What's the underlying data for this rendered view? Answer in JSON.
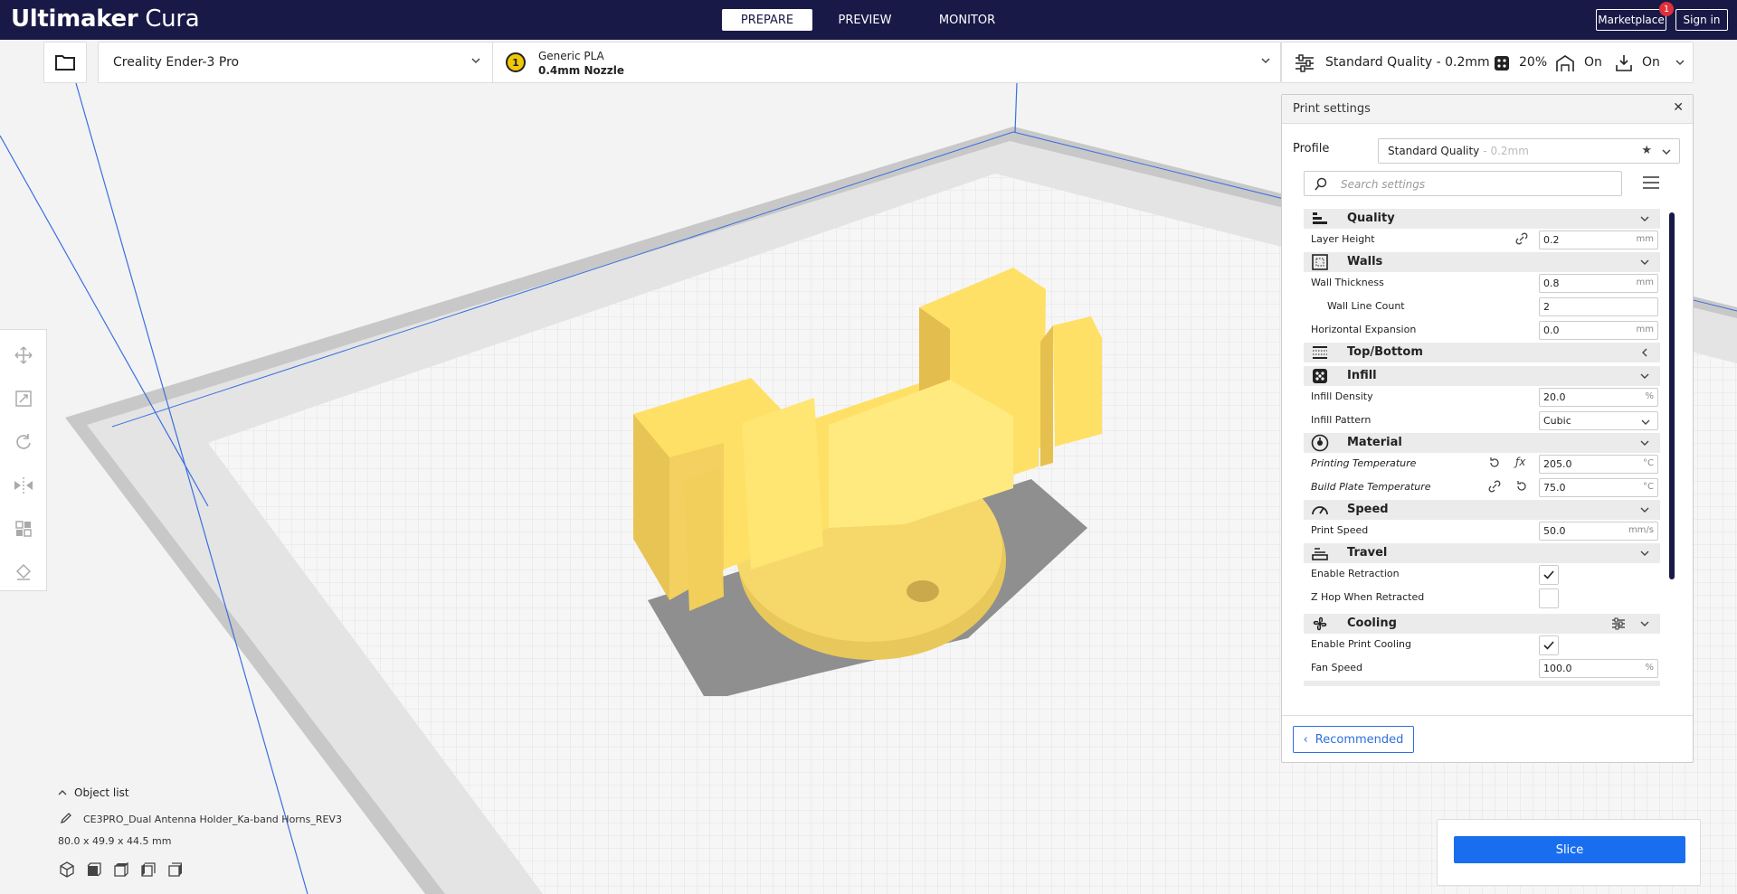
{
  "app": {
    "brand_bold": "Ultimaker",
    "brand_light": "Cura"
  },
  "stages": [
    {
      "label": "PREPARE"
    },
    {
      "label": "PREVIEW"
    },
    {
      "label": "MONITOR"
    }
  ],
  "header": {
    "marketplace": "Marketplace",
    "marketplace_badge": "1",
    "signin": "Sign in"
  },
  "machine": {
    "printer": "Creality Ender-3 Pro",
    "extruder_number": "1",
    "material": "Generic PLA",
    "nozzle": "0.4mm Nozzle"
  },
  "print_setup": {
    "quality": "Standard Quality - 0.2mm",
    "infill": "20%",
    "support": "On",
    "adhesion": "On"
  },
  "panel": {
    "title": "Print settings",
    "close": "✕",
    "profile_label": "Profile",
    "profile_value": "Standard Quality",
    "profile_sub": "- 0.2mm",
    "search_placeholder": "Search settings",
    "recommended_label": "Recommended",
    "categories": [
      {
        "label": "Quality"
      },
      {
        "label": "Walls"
      },
      {
        "label": "Top/Bottom"
      },
      {
        "label": "Infill"
      },
      {
        "label": "Material"
      },
      {
        "label": "Speed"
      },
      {
        "label": "Travel"
      },
      {
        "label": "Cooling"
      }
    ],
    "settings": {
      "layer_height": {
        "label": "Layer Height",
        "value": "0.2",
        "unit": "mm"
      },
      "wall_thickness": {
        "label": "Wall Thickness",
        "value": "0.8",
        "unit": "mm"
      },
      "wall_line_count": {
        "label": "Wall Line Count",
        "value": "2"
      },
      "horizontal_expansion": {
        "label": "Horizontal Expansion",
        "value": "0.0",
        "unit": "mm"
      },
      "infill_density": {
        "label": "Infill Density",
        "value": "20.0",
        "unit": "%"
      },
      "infill_pattern": {
        "label": "Infill Pattern",
        "value": "Cubic"
      },
      "printing_temperature": {
        "label": "Printing Temperature",
        "value": "205.0",
        "unit": "°C"
      },
      "build_plate_temperature": {
        "label": "Build Plate Temperature",
        "value": "75.0",
        "unit": "°C"
      },
      "print_speed": {
        "label": "Print Speed",
        "value": "50.0",
        "unit": "mm/s"
      },
      "enable_retraction": {
        "label": "Enable Retraction",
        "checked": true
      },
      "z_hop": {
        "label": "Z Hop When Retracted",
        "checked": false
      },
      "enable_print_cooling": {
        "label": "Enable Print Cooling",
        "checked": true
      },
      "fan_speed": {
        "label": "Fan Speed",
        "value": "100.0",
        "unit": "%"
      }
    }
  },
  "objects": {
    "toggle_label": "Object list",
    "name": "CE3PRO_Dual Antenna Holder_Ka-band Horns_REV3",
    "dimensions": "80.0 x 49.9 x 44.5 mm"
  },
  "slice": {
    "label": "Slice"
  },
  "colors": {
    "topbar": "#191948",
    "accent": "#196ef0",
    "model": "#ffe066",
    "shadow": "#808080"
  }
}
